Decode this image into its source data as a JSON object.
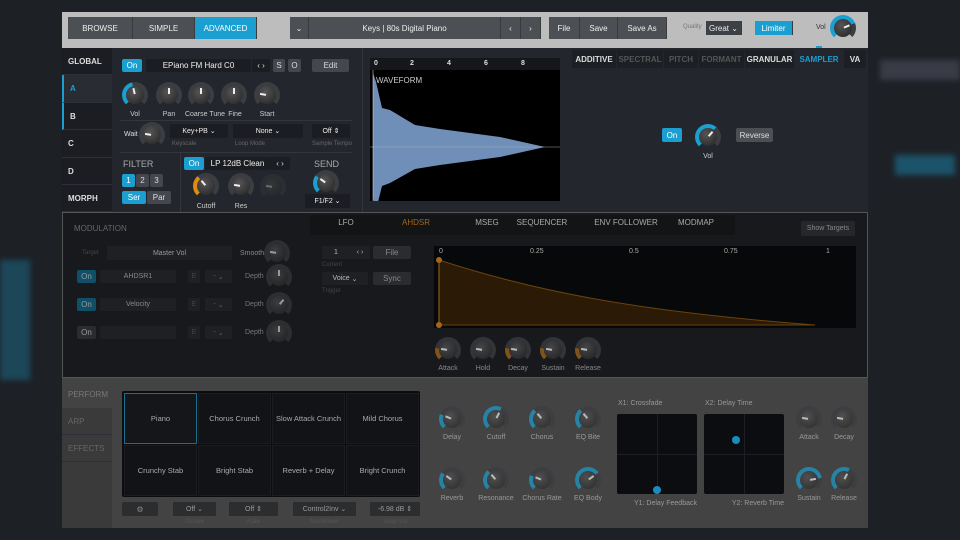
{
  "colors": {
    "accent": "#1a9fd0",
    "envelope": "#c07a10"
  },
  "topbar": {
    "modes": [
      "BROWSE",
      "SIMPLE",
      "ADVANCED"
    ],
    "active_mode": "ADVANCED",
    "preset": "Keys | 80s Digital Piano",
    "file": "File",
    "save": "Save",
    "save_as": "Save As",
    "quality_label": "Quality",
    "quality": "Great",
    "limiter": "Limiter",
    "vol_label": "Vol",
    "vol": {
      "value": 0.75,
      "arc": "#1a9fd0"
    }
  },
  "sidebar": [
    "GLOBAL",
    "A",
    "B",
    "C",
    "D",
    "MORPH"
  ],
  "engine": {
    "on": "On",
    "sample": "EPiano FM Hard C0",
    "s": "S",
    "o": "O",
    "edit": "Edit",
    "knobs": [
      {
        "label": "Vol",
        "value": 0.45,
        "arc": "#1a9fd0"
      },
      {
        "label": "Pan",
        "value": 0.5
      },
      {
        "label": "Coarse Tune",
        "value": 0.5
      },
      {
        "label": "Fine",
        "value": 0.5
      },
      {
        "label": "Start",
        "value": 0.2
      }
    ],
    "wait": {
      "label": "Wait",
      "value": 0.2
    },
    "keyscale": {
      "value": "Key+PB",
      "label": "Keyscale"
    },
    "loop": {
      "value": "None",
      "label": "Loop Mode"
    },
    "tempo": {
      "value": "Off",
      "label": "Sample Tempo"
    },
    "filter": {
      "title": "FILTER",
      "nums": [
        "1",
        "2",
        "3"
      ],
      "ser": "Ser",
      "par": "Par",
      "on": "On",
      "type": "LP 12dB Clean",
      "cutoff": {
        "label": "Cutoff",
        "value": 0.35,
        "arc": "#e08a10"
      },
      "res": {
        "label": "Res",
        "value": 0.2
      },
      "third": {
        "value": 0.2
      }
    },
    "send": {
      "title": "SEND",
      "value": 0.3,
      "arc": "#1a9fd0",
      "route": "F1/F2"
    }
  },
  "waveform": {
    "label": "WAVEFORM",
    "ticks": [
      "0",
      "2",
      "4",
      "6",
      "8"
    ]
  },
  "engine_tabs": [
    {
      "label": "ADDITIVE",
      "state": "on"
    },
    {
      "label": "SPECTRAL",
      "state": "off"
    },
    {
      "label": "PITCH",
      "state": "off"
    },
    {
      "label": "FORMANT",
      "state": "off"
    },
    {
      "label": "GRANULAR",
      "state": "on"
    },
    {
      "label": "SAMPLER",
      "state": "active"
    },
    {
      "label": "VA",
      "state": "on"
    }
  ],
  "sampler": {
    "on": "On",
    "vol": {
      "label": "Vol",
      "value": 0.65,
      "arc": "#1a9fd0"
    },
    "reverse": "Reverse"
  },
  "modulation": {
    "title": "MODULATION",
    "target_label": "Target",
    "target": "Master Vol",
    "smooth": {
      "label": "Smooth",
      "value": 0.2
    },
    "rows": [
      {
        "on": "On",
        "source": "AHDSR1",
        "e": "E",
        "via": "-",
        "depth_label": "Depth",
        "depth": 0.5,
        "active": true
      },
      {
        "on": "On",
        "source": "Velocity",
        "e": "E",
        "via": "-",
        "depth_label": "Depth",
        "depth": 0.65,
        "active": true
      },
      {
        "on": "On",
        "source": "",
        "e": "E",
        "via": "-",
        "depth_label": "Depth",
        "depth": 0.5,
        "active": false
      }
    ],
    "tabs": [
      "LFO",
      "AHDSR",
      "MSEG",
      "SEQUENCER",
      "ENV FOLLOWER",
      "MODMAP"
    ],
    "active_tab": "AHDSR",
    "show_targets": "Show Targets",
    "current": {
      "value": "1",
      "label": "Current"
    },
    "file": "File",
    "trigger": {
      "value": "Voice",
      "label": "Trigger"
    },
    "sync": "Sync",
    "env_ticks": [
      "0",
      "0.25",
      "0.5",
      "0.75",
      "1"
    ],
    "env_knobs": [
      {
        "label": "Attack",
        "value": 0.2
      },
      {
        "label": "Hold",
        "value": 0.2
      },
      {
        "label": "Decay",
        "value": 0.2
      },
      {
        "label": "Sustain",
        "value": 0.2
      },
      {
        "label": "Release",
        "value": 0.2
      }
    ]
  },
  "perform": {
    "tabs": [
      "PERFORM",
      "ARP",
      "EFFECTS"
    ],
    "pads": [
      "Piano",
      "Chorus Crunch",
      "Slow Attack Crunch",
      "Mild Chorus",
      "Crunchy Stab",
      "Bright Stab",
      "Reverb + Delay",
      "Bright Crunch"
    ],
    "selected_pad": "Piano",
    "controls": [
      {
        "value": "Off",
        "label": "Octave"
      },
      {
        "value": "Off",
        "label": "Rate"
      },
      {
        "value": "Control2Inv",
        "label": "ModWheel"
      },
      {
        "value": "-6.98 dB",
        "label": "Snap Vol"
      }
    ],
    "knobs": [
      {
        "label": "Delay",
        "value": 0.25,
        "arc": "#1a9fd0"
      },
      {
        "label": "Cutoff",
        "value": 0.6,
        "arc": "#1a9fd0"
      },
      {
        "label": "Chorus",
        "value": 0.35,
        "arc": "#1a9fd0"
      },
      {
        "label": "EQ Bite",
        "value": 0.35,
        "arc": "#1a9fd0"
      },
      {
        "label": "Reverb",
        "value": 0.3,
        "arc": "#1a9fd0"
      },
      {
        "label": "Resonance",
        "value": 0.35,
        "arc": "#1a9fd0"
      },
      {
        "label": "Chorus Rate",
        "value": 0.25,
        "arc": "#1a9fd0"
      },
      {
        "label": "EQ Body",
        "value": 0.7,
        "arc": "#1a9fd0"
      }
    ],
    "xy": [
      {
        "x_label": "X1: Crossfade",
        "y_label": "Y1: Delay Feedback"
      },
      {
        "x_label": "X2: Delay Time",
        "y_label": "Y2: Reverb Time"
      }
    ],
    "env": [
      {
        "label": "Attack",
        "value": 0.2
      },
      {
        "label": "Decay",
        "value": 0.2
      },
      {
        "label": "Sustain",
        "value": 0.8,
        "arc": "#1a9fd0"
      },
      {
        "label": "Release",
        "value": 0.6,
        "arc": "#1a9fd0"
      }
    ]
  }
}
